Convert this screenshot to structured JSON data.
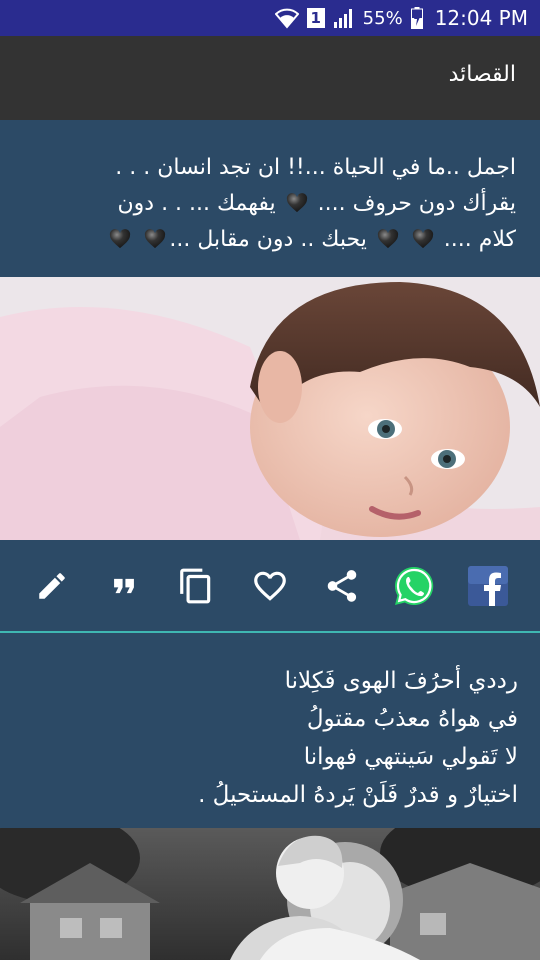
{
  "status_bar": {
    "sim_label": "1",
    "battery": "55%",
    "time": "12:04 PM"
  },
  "app_bar": {
    "title": "القصائد"
  },
  "posts": [
    {
      "lines": [
        "اجمل ..ما في الحياة ...!! ان تجد انسان . . .",
        "يقرأك دون حروف .... 🖤 يفهمك ... . . دون",
        "كلام .... 🖤 🖤 يحبك .. دون مقابل ...🖤 🖤"
      ],
      "photo": "baby-portrait"
    },
    {
      "lines": [
        "رددي أحرُفَ الهوى فَكِلانا",
        "في هواهُ معذبُ مقتولُ",
        "لا تَقولي سَينتهي فهوانا",
        "اختيارٌ و قدرٌ فَلَنْ يَردهُ المستحيلُ ."
      ],
      "photo": "two-children-hugging"
    }
  ],
  "actions": [
    {
      "name": "edit-icon"
    },
    {
      "name": "quote-icon"
    },
    {
      "name": "copy-icon"
    },
    {
      "name": "heart-icon"
    },
    {
      "name": "share-icon"
    },
    {
      "name": "whatsapp-icon",
      "color": "#25D366"
    },
    {
      "name": "facebook-icon",
      "color": "#3b5998"
    }
  ],
  "colors": {
    "status_bar": "#2a2c8f",
    "app_bar": "#333333",
    "post_background": "#2c4a66",
    "divider": "#3fb7b2"
  }
}
